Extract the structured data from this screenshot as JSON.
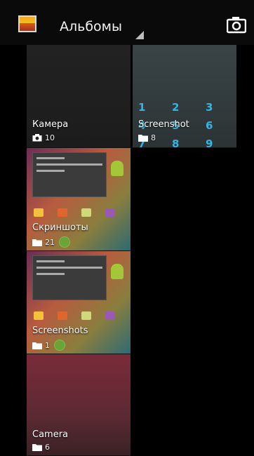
{
  "action_bar": {
    "title": "Альбомы",
    "app_icon": "gallery-icon",
    "camera_icon": "camera-icon"
  },
  "albums": [
    {
      "name": "Камера",
      "count": "10",
      "type_icon": "camera-icon"
    },
    {
      "name": "Screenshot",
      "count": "8",
      "type_icon": "folder-icon"
    },
    {
      "name": "Скриншоты",
      "count": "21",
      "type_icon": "folder-icon"
    },
    {
      "name": "Screenshots",
      "count": "1",
      "type_icon": "folder-icon"
    },
    {
      "name": "Camera",
      "count": "6",
      "type_icon": "folder-icon"
    }
  ],
  "dialpad_keys": [
    "1",
    "2",
    "3",
    "4",
    "5",
    "6",
    "7",
    "8",
    "9"
  ],
  "colors": {
    "accent": "#33b5e5",
    "background": "#000000"
  }
}
